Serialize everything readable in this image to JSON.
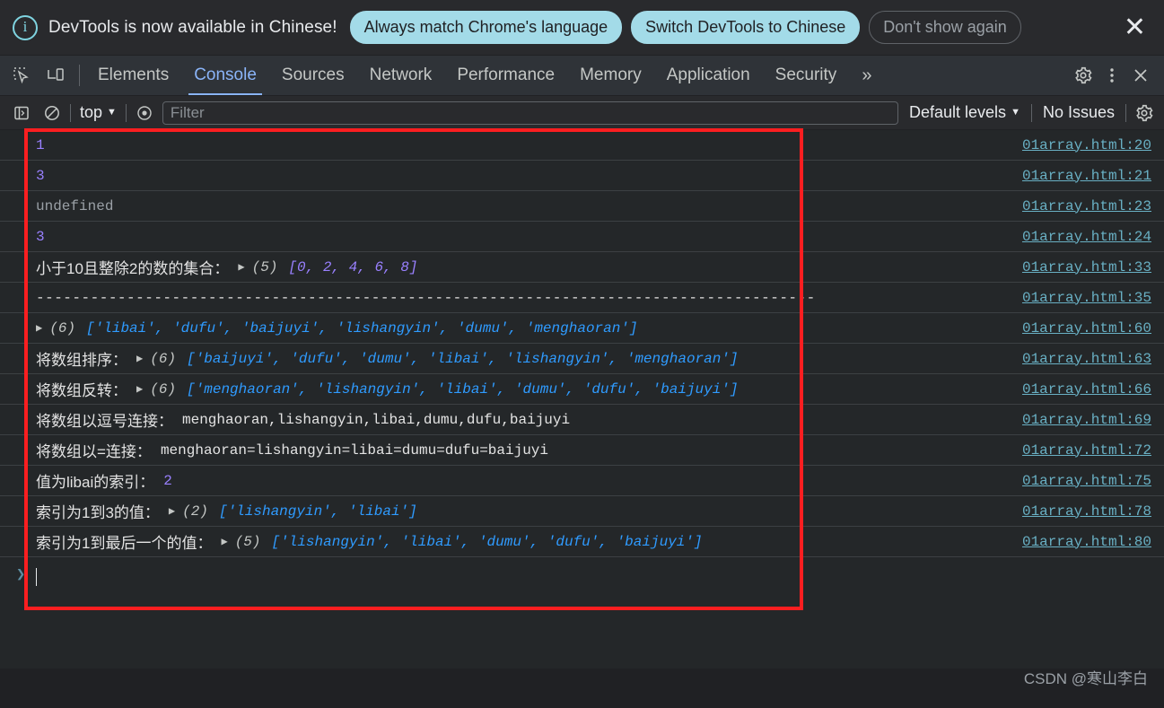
{
  "banner": {
    "icon": "info-circle-icon",
    "message": "DevTools is now available in Chinese!",
    "buttons": [
      {
        "label": "Always match Chrome's language",
        "style": "primary"
      },
      {
        "label": "Switch DevTools to Chinese",
        "style": "primary"
      },
      {
        "label": "Don't show again",
        "style": "ghost"
      }
    ],
    "close_glyph": "✕"
  },
  "tabstrip": {
    "left_icons": [
      {
        "name": "inspect-element-icon"
      },
      {
        "name": "device-toolbar-icon"
      }
    ],
    "tabs": [
      {
        "label": "Elements",
        "active": false
      },
      {
        "label": "Console",
        "active": true
      },
      {
        "label": "Sources",
        "active": false
      },
      {
        "label": "Network",
        "active": false
      },
      {
        "label": "Performance",
        "active": false
      },
      {
        "label": "Memory",
        "active": false
      },
      {
        "label": "Application",
        "active": false
      },
      {
        "label": "Security",
        "active": false
      }
    ],
    "more_glyph": "»",
    "right_icons": [
      {
        "name": "settings-gear-icon"
      },
      {
        "name": "more-vertical-icon"
      },
      {
        "name": "close-devtools-icon"
      }
    ],
    "accent_color": "#8ab4f8"
  },
  "console_toolbar": {
    "sidebar_toggle": "console-sidebar-icon",
    "clear_console": "clear-console-icon",
    "context": "top",
    "context_caret": "▼",
    "live_expression": "eye-icon",
    "filter_placeholder": "Filter",
    "filter_value": "",
    "levels_label": "Default levels",
    "levels_caret": "▼",
    "issues_label": "No Issues",
    "settings": "settings-gear-icon"
  },
  "console_rows": [
    {
      "type": "number",
      "segments": [
        {
          "kind": "num",
          "text": "1"
        }
      ],
      "source": "01array.html:20"
    },
    {
      "type": "number",
      "segments": [
        {
          "kind": "num",
          "text": "3"
        }
      ],
      "source": "01array.html:21"
    },
    {
      "type": "undefined",
      "segments": [
        {
          "kind": "undef",
          "text": "undefined"
        }
      ],
      "source": "01array.html:23"
    },
    {
      "type": "number",
      "segments": [
        {
          "kind": "num",
          "text": "3"
        }
      ],
      "source": "01array.html:24"
    },
    {
      "type": "array",
      "label": "小于10且整除2的数的集合：",
      "disclosure": "▶",
      "count": "(5)",
      "array_open": "[",
      "array_close": "]",
      "array_items": [
        "0",
        "2",
        "4",
        "6",
        "8"
      ],
      "array_kind": "num",
      "source": "01array.html:33"
    },
    {
      "type": "text",
      "segments": [
        {
          "kind": "dashes",
          "text": "--------------------------------------------------------------------------------------"
        }
      ],
      "source": "01array.html:35"
    },
    {
      "type": "array",
      "label": "",
      "disclosure": "▶",
      "count": "(6)",
      "array_open": "[",
      "array_close": "]",
      "array_items": [
        "'libai'",
        "'dufu'",
        "'baijuyi'",
        "'lishangyin'",
        "'dumu'",
        "'menghaoran'"
      ],
      "array_kind": "str",
      "source": "01array.html:60"
    },
    {
      "type": "array",
      "label": "将数组排序：",
      "disclosure": "▶",
      "count": "(6)",
      "array_open": "[",
      "array_close": "]",
      "array_items": [
        "'baijuyi'",
        "'dufu'",
        "'dumu'",
        "'libai'",
        "'lishangyin'",
        "'menghaoran'"
      ],
      "array_kind": "str",
      "source": "01array.html:63"
    },
    {
      "type": "array",
      "label": "将数组反转：",
      "disclosure": "▶",
      "count": "(6)",
      "array_open": "[",
      "array_close": "]",
      "array_items": [
        "'menghaoran'",
        "'lishangyin'",
        "'libai'",
        "'dumu'",
        "'dufu'",
        "'baijuyi'"
      ],
      "array_kind": "str",
      "source": "01array.html:66"
    },
    {
      "type": "labeled-text",
      "label": "将数组以逗号连接：",
      "value": "menghaoran,lishangyin,libai,dumu,dufu,baijuyi",
      "value_kind": "plain",
      "source": "01array.html:69"
    },
    {
      "type": "labeled-text",
      "label": "将数组以=连接：",
      "value": "menghaoran=lishangyin=libai=dumu=dufu=baijuyi",
      "value_kind": "plain",
      "source": "01array.html:72"
    },
    {
      "type": "labeled-text",
      "label": "值为libai的索引：",
      "value": "2",
      "value_kind": "num",
      "source": "01array.html:75"
    },
    {
      "type": "array",
      "label": "索引为1到3的值：",
      "disclosure": "▶",
      "count": "(2)",
      "array_open": "[",
      "array_close": "]",
      "array_items": [
        "'lishangyin'",
        "'libai'"
      ],
      "array_kind": "str",
      "source": "01array.html:78"
    },
    {
      "type": "array",
      "label": "索引为1到最后一个的值：",
      "disclosure": "▶",
      "count": "(5)",
      "array_open": "[",
      "array_close": "]",
      "array_items": [
        "'lishangyin'",
        "'libai'",
        "'dumu'",
        "'dufu'",
        "'baijuyi'"
      ],
      "array_kind": "str",
      "source": "01array.html:80"
    }
  ],
  "prompt": {
    "caret": "❯",
    "value": ""
  },
  "annotation": {
    "shape": "rectangle",
    "color": "#fb1e20"
  },
  "watermark": "CSDN @寒山李白"
}
